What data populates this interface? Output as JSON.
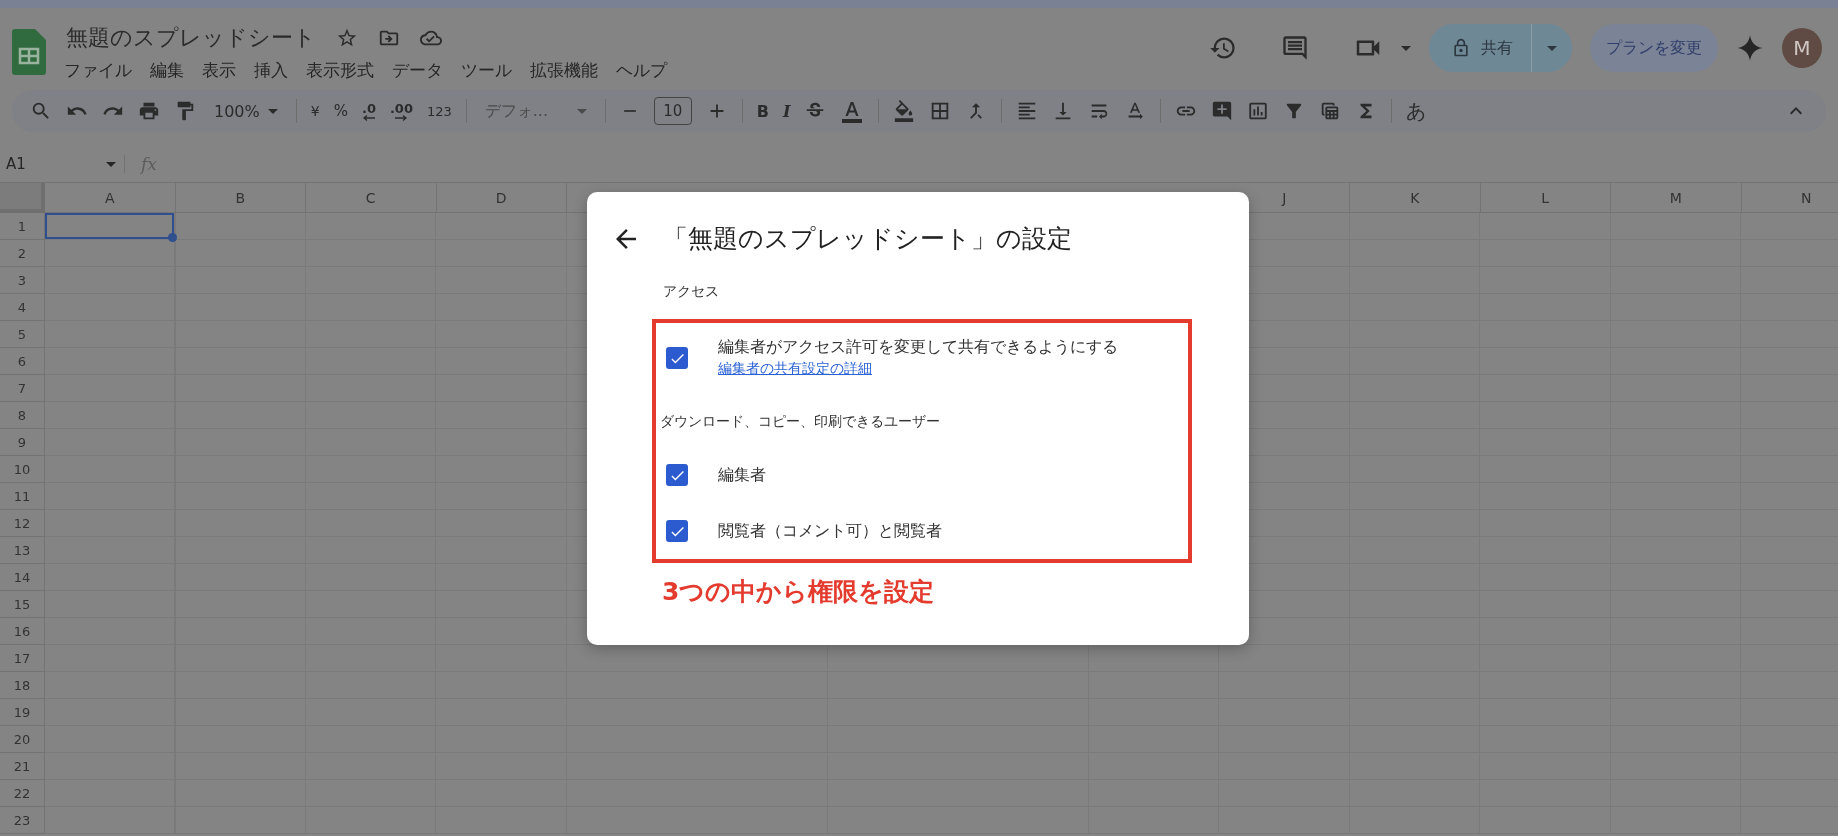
{
  "document": {
    "title": "無題のスプレッドシート"
  },
  "menu": [
    "ファイル",
    "編集",
    "表示",
    "挿入",
    "表示形式",
    "データ",
    "ツール",
    "拡張機能",
    "ヘルプ"
  ],
  "header_actions": {
    "share": "共有",
    "upgrade": "プランを変更",
    "avatar": "M"
  },
  "toolbar": {
    "zoom": "100%",
    "currency": "¥",
    "percent": "%",
    "decrease_decimal": ".0",
    "increase_decimal": ".00",
    "number_format": "123",
    "font": "デフォ...",
    "font_size": "10",
    "bold": "B",
    "italic": "I",
    "input_mode": "あ"
  },
  "formula_bar": {
    "name_box": "A1",
    "function_label": "fx"
  },
  "grid": {
    "columns_left": [
      "A",
      "B",
      "C",
      "D"
    ],
    "columns_right": [
      "J",
      "K",
      "L",
      "M",
      "N"
    ],
    "rows": [
      "1",
      "2",
      "3",
      "4",
      "5",
      "6",
      "7",
      "8",
      "9",
      "10",
      "11",
      "12",
      "13",
      "14",
      "15",
      "16",
      "17",
      "18",
      "19",
      "20",
      "21",
      "22",
      "23"
    ]
  },
  "dialog": {
    "title": "「無題のスプレッドシート」の設定",
    "sections": [
      {
        "heading": "アクセス",
        "options": [
          {
            "label": "編集者がアクセス許可を変更して共有できるようにする",
            "link": "編集者の共有設定の詳細",
            "checked": true
          }
        ]
      },
      {
        "heading": "ダウンロード、コピー、印刷できるユーザー",
        "options": [
          {
            "label": "編集者",
            "checked": true
          },
          {
            "label": "閲覧者（コメント可）と閲覧者",
            "checked": true
          }
        ]
      }
    ],
    "annotation": "3つの中から権限を設定"
  }
}
